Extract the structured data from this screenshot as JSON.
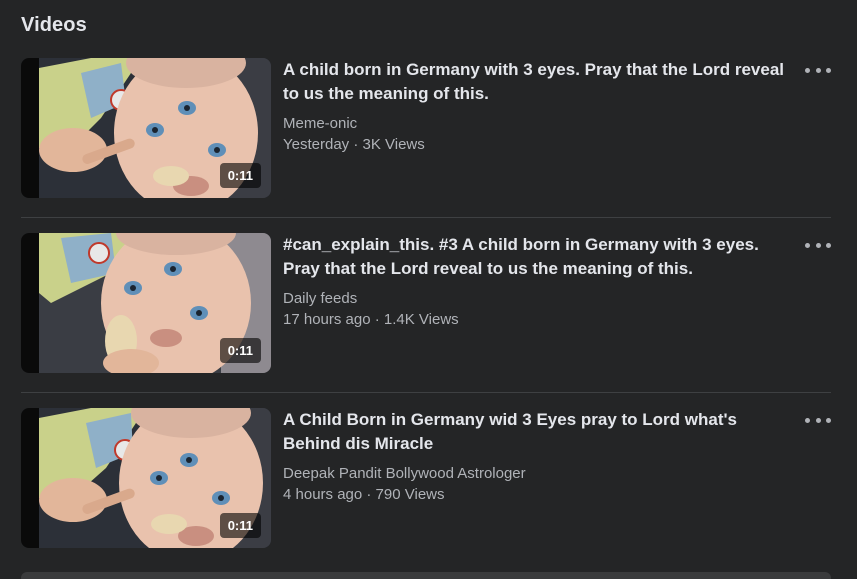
{
  "section": {
    "title": "Videos"
  },
  "videos": [
    {
      "title": "A child born in Germany with 3 eyes. Pray that the Lord reveal to us the meaning of this.",
      "channel": "Meme-onic",
      "meta": "Yesterday · 3K Views",
      "duration": "0:11"
    },
    {
      "title": "#can_explain_this. #3 A child born in Germany with 3 eyes. Pray that the Lord reveal to us the meaning of this.",
      "channel": "Daily feeds",
      "meta": "17 hours ago · 1.4K Views",
      "duration": "0:11"
    },
    {
      "title": "A Child Born in Germany wid 3 Eyes pray to Lord what's Behind dis Miracle",
      "channel": "Deepak Pandit Bollywood Astrologer",
      "meta": "4 hours ago · 790 Views",
      "duration": "0:11"
    }
  ],
  "icons": {
    "more": "more-options-icon",
    "thumbnail": "baby-video-thumbnail"
  },
  "colors": {
    "background": "#242526",
    "text_primary": "#e4e6eb",
    "text_secondary": "#b0b3b8",
    "divider": "#3e4042"
  }
}
